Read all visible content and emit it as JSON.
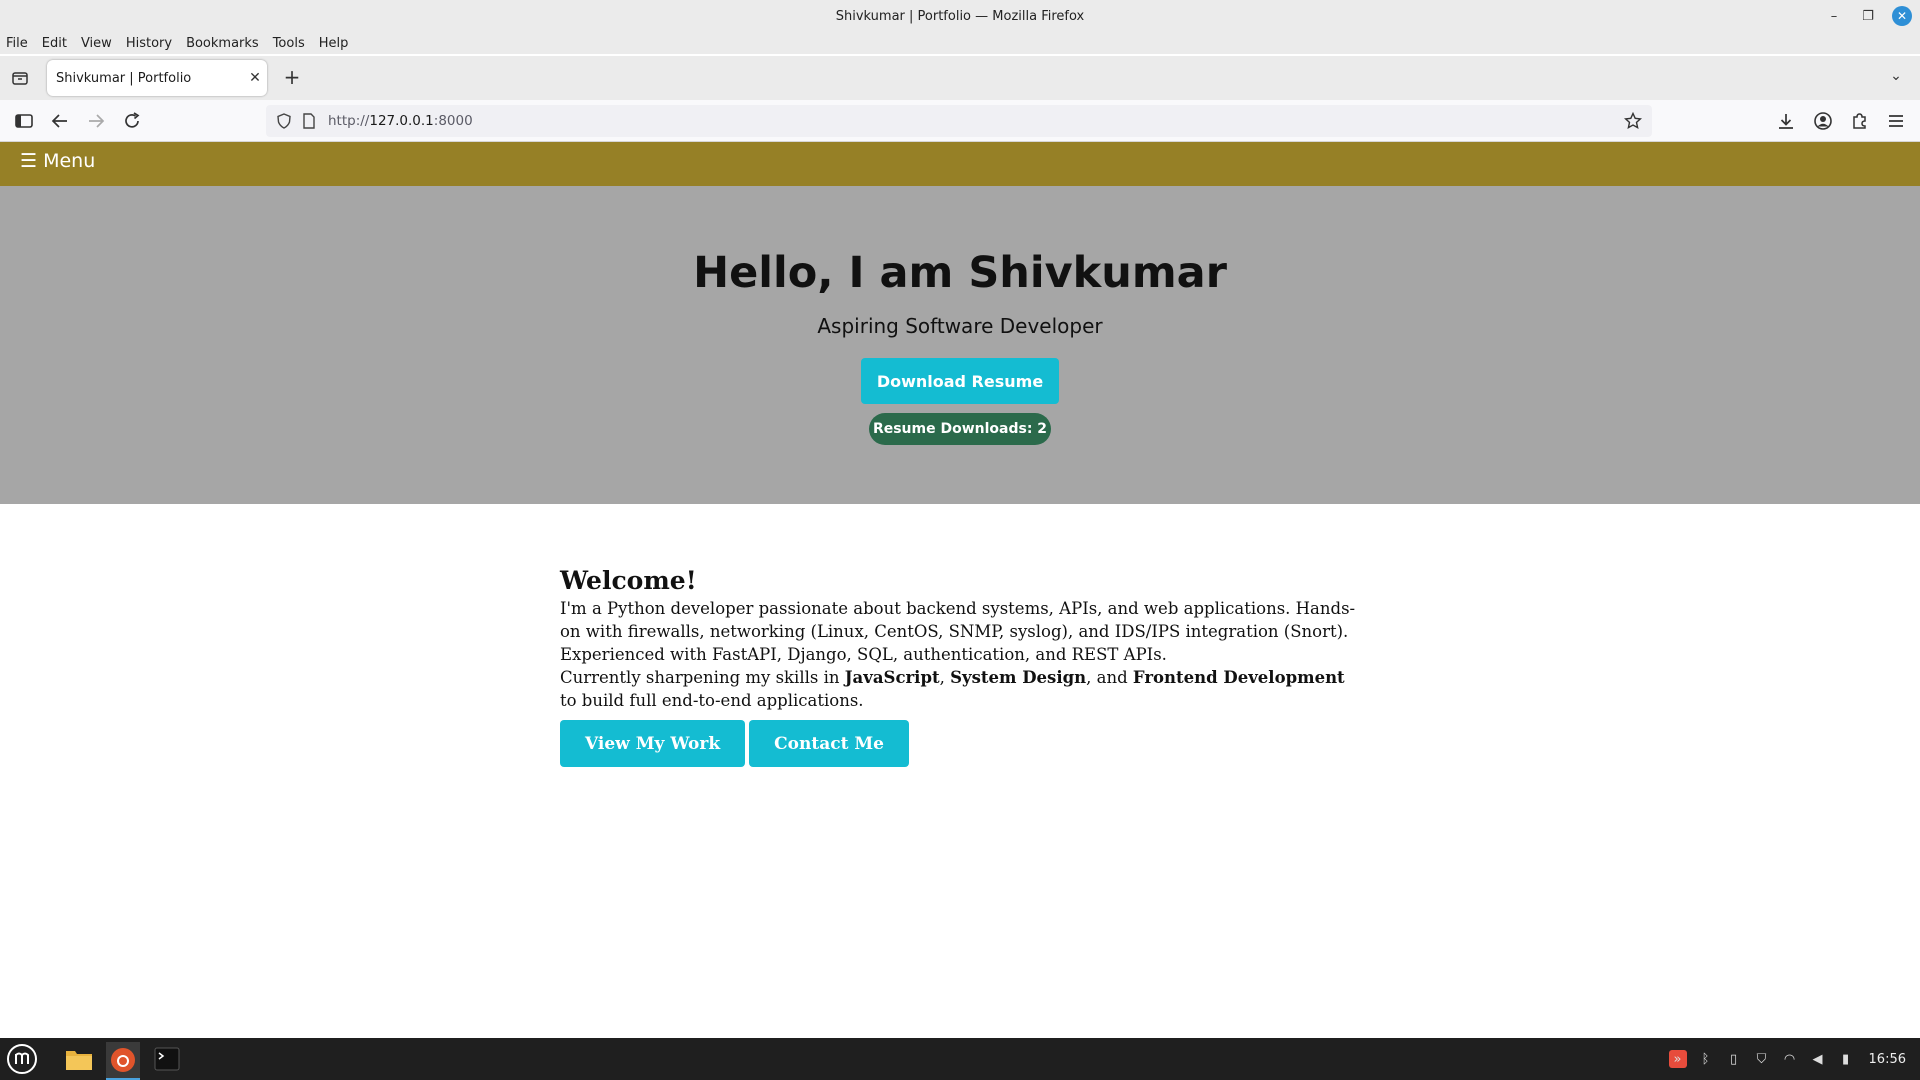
{
  "window": {
    "title": "Shivkumar | Portfolio — Mozilla Firefox"
  },
  "menubar": {
    "items": [
      "File",
      "Edit",
      "View",
      "History",
      "Bookmarks",
      "Tools",
      "Help"
    ]
  },
  "tabs": [
    {
      "title": "Shivkumar | Portfolio"
    }
  ],
  "urlbar": {
    "scheme": "http://",
    "host": "127.0.0.1",
    "port": ":8000"
  },
  "page": {
    "nav": {
      "menu_label": "☰ Menu"
    },
    "hero": {
      "heading": "Hello, I am Shivkumar",
      "tagline": "Aspiring Software Developer",
      "download_button": "Download Resume",
      "downloads_badge": "Resume Downloads: 2"
    },
    "about": {
      "title": "Welcome!",
      "paragraph1": "I'm a Python developer passionate about backend systems, APIs, and web applications. Hands-on with firewalls, networking (Linux, CentOS, SNMP, syslog), and IDS/IPS integration (Snort). Experienced with FastAPI, Django, SQL, authentication, and REST APIs.",
      "paragraph2_prefix": "Currently sharpening my skills in ",
      "skill1": "JavaScript",
      "sep1": ", ",
      "skill2": "System Design",
      "sep2": ", and ",
      "skill3": "Frontend Development",
      "paragraph2_suffix": " to build full end-to-end applications.",
      "view_work_button": "View My Work",
      "contact_button": "Contact Me"
    }
  },
  "taskbar": {
    "clock": "16:56"
  },
  "colors": {
    "nav_bg": "#968026",
    "hero_bg": "#a6a6a6",
    "accent_button": "#14bcd2",
    "badge_bg": "#2b6a4b"
  }
}
